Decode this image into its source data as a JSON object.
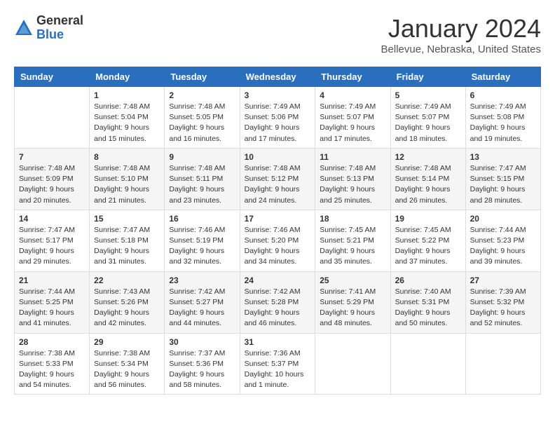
{
  "header": {
    "logo_general": "General",
    "logo_blue": "Blue",
    "month_title": "January 2024",
    "location": "Bellevue, Nebraska, United States"
  },
  "weekdays": [
    "Sunday",
    "Monday",
    "Tuesday",
    "Wednesday",
    "Thursday",
    "Friday",
    "Saturday"
  ],
  "weeks": [
    [
      {
        "day": "",
        "sunrise": "",
        "sunset": "",
        "daylight": ""
      },
      {
        "day": "1",
        "sunrise": "Sunrise: 7:48 AM",
        "sunset": "Sunset: 5:04 PM",
        "daylight": "Daylight: 9 hours and 15 minutes."
      },
      {
        "day": "2",
        "sunrise": "Sunrise: 7:48 AM",
        "sunset": "Sunset: 5:05 PM",
        "daylight": "Daylight: 9 hours and 16 minutes."
      },
      {
        "day": "3",
        "sunrise": "Sunrise: 7:49 AM",
        "sunset": "Sunset: 5:06 PM",
        "daylight": "Daylight: 9 hours and 17 minutes."
      },
      {
        "day": "4",
        "sunrise": "Sunrise: 7:49 AM",
        "sunset": "Sunset: 5:07 PM",
        "daylight": "Daylight: 9 hours and 17 minutes."
      },
      {
        "day": "5",
        "sunrise": "Sunrise: 7:49 AM",
        "sunset": "Sunset: 5:07 PM",
        "daylight": "Daylight: 9 hours and 18 minutes."
      },
      {
        "day": "6",
        "sunrise": "Sunrise: 7:49 AM",
        "sunset": "Sunset: 5:08 PM",
        "daylight": "Daylight: 9 hours and 19 minutes."
      }
    ],
    [
      {
        "day": "7",
        "sunrise": "Sunrise: 7:48 AM",
        "sunset": "Sunset: 5:09 PM",
        "daylight": "Daylight: 9 hours and 20 minutes."
      },
      {
        "day": "8",
        "sunrise": "Sunrise: 7:48 AM",
        "sunset": "Sunset: 5:10 PM",
        "daylight": "Daylight: 9 hours and 21 minutes."
      },
      {
        "day": "9",
        "sunrise": "Sunrise: 7:48 AM",
        "sunset": "Sunset: 5:11 PM",
        "daylight": "Daylight: 9 hours and 23 minutes."
      },
      {
        "day": "10",
        "sunrise": "Sunrise: 7:48 AM",
        "sunset": "Sunset: 5:12 PM",
        "daylight": "Daylight: 9 hours and 24 minutes."
      },
      {
        "day": "11",
        "sunrise": "Sunrise: 7:48 AM",
        "sunset": "Sunset: 5:13 PM",
        "daylight": "Daylight: 9 hours and 25 minutes."
      },
      {
        "day": "12",
        "sunrise": "Sunrise: 7:48 AM",
        "sunset": "Sunset: 5:14 PM",
        "daylight": "Daylight: 9 hours and 26 minutes."
      },
      {
        "day": "13",
        "sunrise": "Sunrise: 7:47 AM",
        "sunset": "Sunset: 5:15 PM",
        "daylight": "Daylight: 9 hours and 28 minutes."
      }
    ],
    [
      {
        "day": "14",
        "sunrise": "Sunrise: 7:47 AM",
        "sunset": "Sunset: 5:17 PM",
        "daylight": "Daylight: 9 hours and 29 minutes."
      },
      {
        "day": "15",
        "sunrise": "Sunrise: 7:47 AM",
        "sunset": "Sunset: 5:18 PM",
        "daylight": "Daylight: 9 hours and 31 minutes."
      },
      {
        "day": "16",
        "sunrise": "Sunrise: 7:46 AM",
        "sunset": "Sunset: 5:19 PM",
        "daylight": "Daylight: 9 hours and 32 minutes."
      },
      {
        "day": "17",
        "sunrise": "Sunrise: 7:46 AM",
        "sunset": "Sunset: 5:20 PM",
        "daylight": "Daylight: 9 hours and 34 minutes."
      },
      {
        "day": "18",
        "sunrise": "Sunrise: 7:45 AM",
        "sunset": "Sunset: 5:21 PM",
        "daylight": "Daylight: 9 hours and 35 minutes."
      },
      {
        "day": "19",
        "sunrise": "Sunrise: 7:45 AM",
        "sunset": "Sunset: 5:22 PM",
        "daylight": "Daylight: 9 hours and 37 minutes."
      },
      {
        "day": "20",
        "sunrise": "Sunrise: 7:44 AM",
        "sunset": "Sunset: 5:23 PM",
        "daylight": "Daylight: 9 hours and 39 minutes."
      }
    ],
    [
      {
        "day": "21",
        "sunrise": "Sunrise: 7:44 AM",
        "sunset": "Sunset: 5:25 PM",
        "daylight": "Daylight: 9 hours and 41 minutes."
      },
      {
        "day": "22",
        "sunrise": "Sunrise: 7:43 AM",
        "sunset": "Sunset: 5:26 PM",
        "daylight": "Daylight: 9 hours and 42 minutes."
      },
      {
        "day": "23",
        "sunrise": "Sunrise: 7:42 AM",
        "sunset": "Sunset: 5:27 PM",
        "daylight": "Daylight: 9 hours and 44 minutes."
      },
      {
        "day": "24",
        "sunrise": "Sunrise: 7:42 AM",
        "sunset": "Sunset: 5:28 PM",
        "daylight": "Daylight: 9 hours and 46 minutes."
      },
      {
        "day": "25",
        "sunrise": "Sunrise: 7:41 AM",
        "sunset": "Sunset: 5:29 PM",
        "daylight": "Daylight: 9 hours and 48 minutes."
      },
      {
        "day": "26",
        "sunrise": "Sunrise: 7:40 AM",
        "sunset": "Sunset: 5:31 PM",
        "daylight": "Daylight: 9 hours and 50 minutes."
      },
      {
        "day": "27",
        "sunrise": "Sunrise: 7:39 AM",
        "sunset": "Sunset: 5:32 PM",
        "daylight": "Daylight: 9 hours and 52 minutes."
      }
    ],
    [
      {
        "day": "28",
        "sunrise": "Sunrise: 7:38 AM",
        "sunset": "Sunset: 5:33 PM",
        "daylight": "Daylight: 9 hours and 54 minutes."
      },
      {
        "day": "29",
        "sunrise": "Sunrise: 7:38 AM",
        "sunset": "Sunset: 5:34 PM",
        "daylight": "Daylight: 9 hours and 56 minutes."
      },
      {
        "day": "30",
        "sunrise": "Sunrise: 7:37 AM",
        "sunset": "Sunset: 5:36 PM",
        "daylight": "Daylight: 9 hours and 58 minutes."
      },
      {
        "day": "31",
        "sunrise": "Sunrise: 7:36 AM",
        "sunset": "Sunset: 5:37 PM",
        "daylight": "Daylight: 10 hours and 1 minute."
      },
      {
        "day": "",
        "sunrise": "",
        "sunset": "",
        "daylight": ""
      },
      {
        "day": "",
        "sunrise": "",
        "sunset": "",
        "daylight": ""
      },
      {
        "day": "",
        "sunrise": "",
        "sunset": "",
        "daylight": ""
      }
    ]
  ]
}
